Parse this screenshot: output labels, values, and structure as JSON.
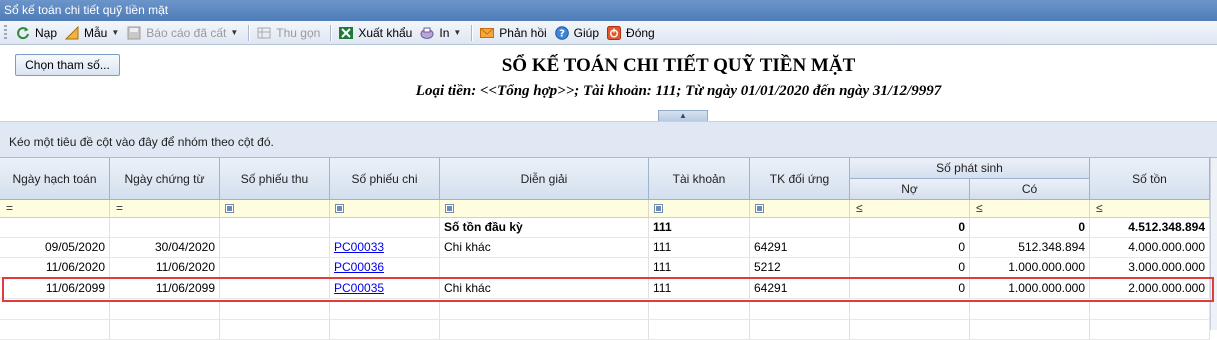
{
  "window": {
    "title": "Sổ kế toán chi tiết quỹ tiền mặt"
  },
  "toolbar": {
    "items": [
      {
        "label": "Nạp",
        "icon": "refresh-icon",
        "disabled": false
      },
      {
        "label": "Mẫu",
        "icon": "template-icon",
        "disabled": false,
        "dropdown": true
      },
      {
        "label": "Báo cáo đã cất",
        "icon": "saved-report-icon",
        "disabled": true,
        "dropdown": true
      },
      {
        "label": "Thu gọn",
        "icon": "collapse-icon",
        "disabled": true
      },
      {
        "label": "Xuất khẩu",
        "icon": "excel-icon",
        "disabled": false
      },
      {
        "label": "In",
        "icon": "printer-icon",
        "disabled": false,
        "dropdown": true
      },
      {
        "label": "Phản hồi",
        "icon": "mail-icon",
        "disabled": false
      },
      {
        "label": "Giúp",
        "icon": "help-icon",
        "disabled": false
      },
      {
        "label": "Đóng",
        "icon": "close-icon",
        "disabled": false
      }
    ]
  },
  "params_button": "Chọn tham số...",
  "report": {
    "title": "SỔ KẾ TOÁN CHI TIẾT QUỸ TIỀN MẶT",
    "subtitle": "Loại tiền: <<Tổng hợp>>; Tài khoản: 111; Từ ngày 01/01/2020 đến ngày 31/12/9997"
  },
  "group_panel_text": "Kéo một tiêu đề cột vào đây để nhóm theo cột đó.",
  "columns": {
    "ngay_hach_toan": "Ngày hạch toán",
    "ngay_chung_tu": "Ngày chứng từ",
    "so_phieu_thu": "Số phiếu thu",
    "so_phieu_chi": "Số phiếu chi",
    "dien_giai": "Diễn giải",
    "tai_khoan": "Tài khoản",
    "tk_doi_ung": "TK đối ứng",
    "so_phat_sinh": "Số phát sinh",
    "no": "Nợ",
    "co": "Có",
    "so_ton": "Số tồn"
  },
  "filter_ops": {
    "eq": "=",
    "le": "≤"
  },
  "rows": [
    {
      "ngay_hach_toan": "",
      "ngay_chung_tu": "",
      "so_phieu_thu": "",
      "so_phieu_chi": "",
      "dien_giai": "Số tồn đầu kỳ",
      "tai_khoan": "111",
      "tk_doi_ung": "",
      "no": "0",
      "co": "0",
      "so_ton": "4.512.348.894",
      "bold": true
    },
    {
      "ngay_hach_toan": "09/05/2020",
      "ngay_chung_tu": "30/04/2020",
      "so_phieu_thu": "",
      "so_phieu_chi": "PC00033",
      "dien_giai": "Chi khác",
      "tai_khoan": "111",
      "tk_doi_ung": "64291",
      "no": "0",
      "co": "512.348.894",
      "so_ton": "4.000.000.000"
    },
    {
      "ngay_hach_toan": "11/06/2020",
      "ngay_chung_tu": "11/06/2020",
      "so_phieu_thu": "",
      "so_phieu_chi": "PC00036",
      "dien_giai": "",
      "tai_khoan": "111",
      "tk_doi_ung": "5212",
      "no": "0",
      "co": "1.000.000.000",
      "so_ton": "3.000.000.000"
    },
    {
      "ngay_hach_toan": "11/06/2099",
      "ngay_chung_tu": "11/06/2099",
      "so_phieu_thu": "",
      "so_phieu_chi": "PC00035",
      "dien_giai": "Chi khác",
      "tai_khoan": "111",
      "tk_doi_ung": "64291",
      "no": "0",
      "co": "1.000.000.000",
      "so_ton": "2.000.000.000",
      "highlighted": true
    }
  ]
}
